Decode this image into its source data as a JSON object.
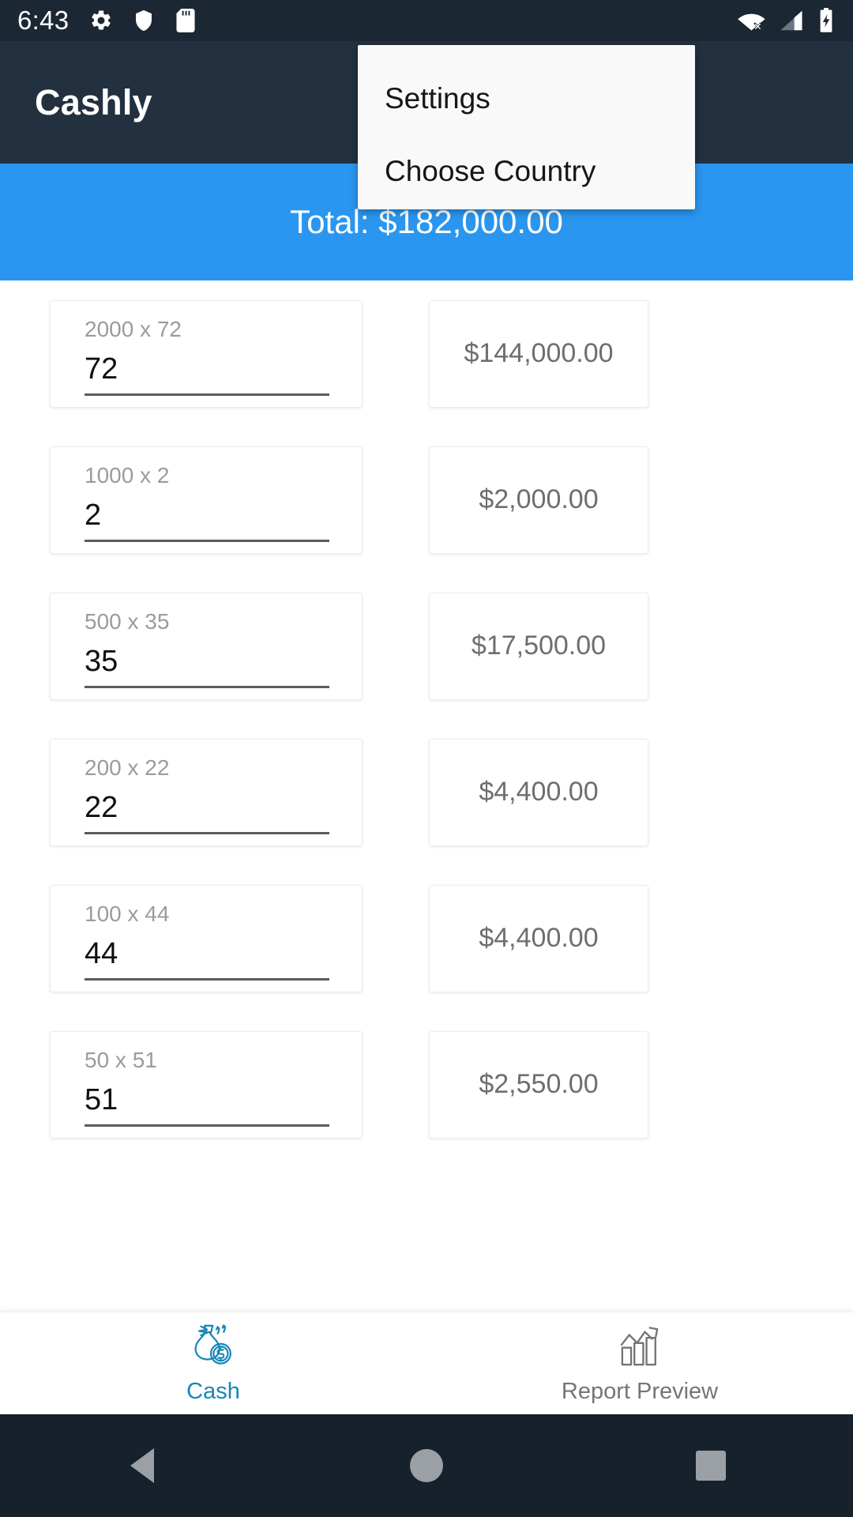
{
  "status_bar": {
    "time": "6:43",
    "left_icons": [
      "gear-icon",
      "shield-icon",
      "sd-card-icon"
    ],
    "right_icons": [
      "wifi-off-icon",
      "cellular-signal-icon",
      "battery-charging-icon"
    ],
    "background_color": "#1b2733"
  },
  "app_bar": {
    "title": "Cashly",
    "background_color": "#22303f",
    "overflow_icon": "more-vert-icon"
  },
  "menu": {
    "items": [
      {
        "label": "Settings"
      },
      {
        "label": "Choose Country"
      }
    ],
    "background_color": "#f9f9f9"
  },
  "total_banner": {
    "text": "Total:  $182,000.00",
    "background_color": "#2a96ef"
  },
  "rows": [
    {
      "hint": "2000 x 72",
      "value": "72",
      "amount": "$144,000.00"
    },
    {
      "hint": "1000 x 2",
      "value": "2",
      "amount": "$2,000.00"
    },
    {
      "hint": "500 x 35",
      "value": "35",
      "amount": "$17,500.00"
    },
    {
      "hint": "200 x 22",
      "value": "22",
      "amount": "$4,400.00"
    },
    {
      "hint": "100 x 44",
      "value": "44",
      "amount": "$4,400.00"
    },
    {
      "hint": "50 x 51",
      "value": "51",
      "amount": "$2,550.00"
    }
  ],
  "bottom_nav": {
    "items": [
      {
        "label": "Cash",
        "icon": "money-bag-icon",
        "active": true
      },
      {
        "label": "Report Preview",
        "icon": "bar-chart-icon",
        "active": false
      }
    ],
    "active_color": "#1787b8",
    "inactive_color": "#757575"
  },
  "android_nav": {
    "buttons": [
      "back-button",
      "home-button",
      "recents-button"
    ],
    "background_color": "#16212c"
  }
}
